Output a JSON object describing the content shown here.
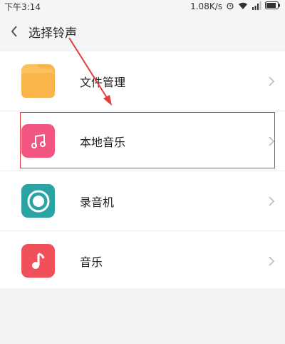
{
  "status_bar": {
    "time": "下午3:14",
    "speed": "1.08K/s"
  },
  "header": {
    "title": "选择铃声"
  },
  "list": {
    "items": [
      {
        "label": "文件管理",
        "icon": "folder-icon",
        "color": "#f9b44a"
      },
      {
        "label": "本地音乐",
        "icon": "music-note-icon",
        "color": "#f2557f"
      },
      {
        "label": "录音机",
        "icon": "recorder-icon",
        "color": "#2aa3a5"
      },
      {
        "label": "音乐",
        "icon": "music-icon",
        "color": "#f0505a"
      }
    ]
  },
  "colors": {
    "highlight": "#e33b3b"
  }
}
